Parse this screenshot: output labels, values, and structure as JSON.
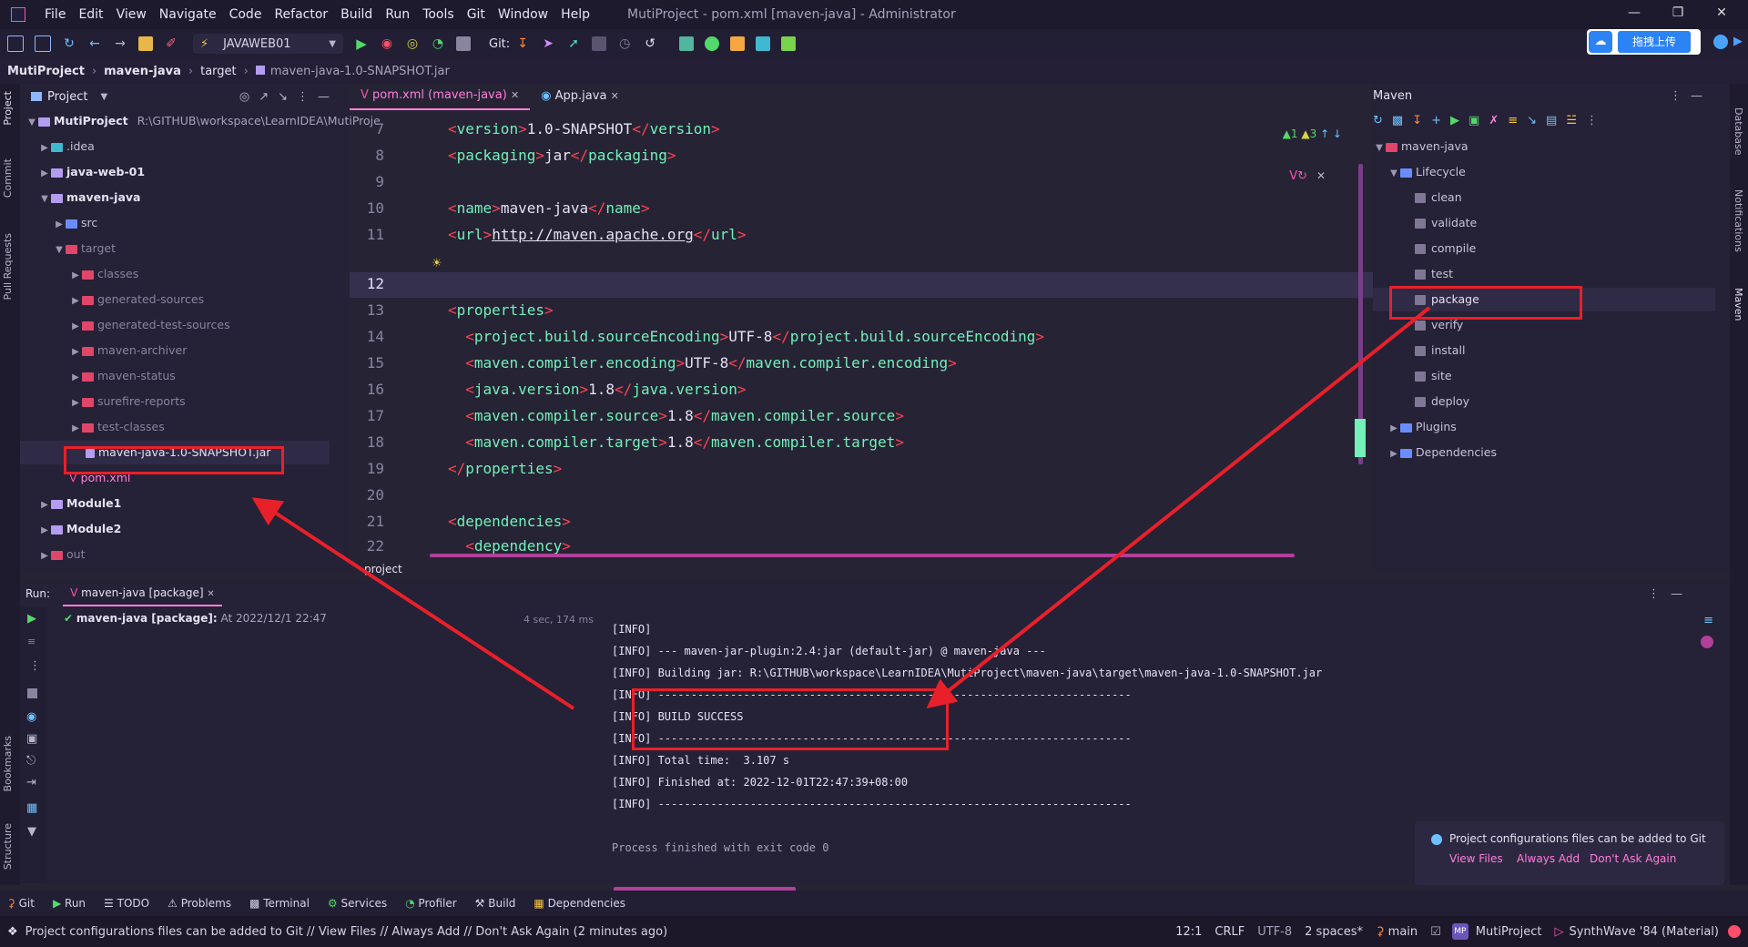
{
  "menubar": {
    "items": [
      "File",
      "Edit",
      "View",
      "Navigate",
      "Code",
      "Refactor",
      "Build",
      "Run",
      "Tools",
      "Git",
      "Window",
      "Help"
    ],
    "title": "MutiProject - pom.xml [maven-java] - Administrator"
  },
  "toolbar": {
    "run_config": "JAVAWEB01",
    "git_label": "Git:",
    "upload_label": "拖拽上传"
  },
  "breadcrumb": [
    "MutiProject",
    "maven-java",
    "target",
    "maven-java-1.0-SNAPSHOT.jar"
  ],
  "left_stripe": [
    "Project",
    "Commit",
    "Pull Requests",
    "Bookmarks",
    "Structure"
  ],
  "project_panel": {
    "title": "Project",
    "root_name": "MutiProject",
    "root_path": "R:\\GITHUB\\workspace\\LearnIDEA\\MutiProje",
    "items": {
      "idea": ".idea",
      "java_web": "java-web-01",
      "maven_java": "maven-java",
      "src": "src",
      "target": "target",
      "classes": "classes",
      "gen_sources": "generated-sources",
      "gen_test_sources": "generated-test-sources",
      "archiver": "maven-archiver",
      "status": "maven-status",
      "surefire": "surefire-reports",
      "test_classes": "test-classes",
      "jar": "maven-java-1.0-SNAPSHOT.jar",
      "pom": "pom.xml",
      "module1": "Module1",
      "module2": "Module2",
      "out": "out"
    }
  },
  "editor": {
    "tabs": [
      "pom.xml (maven-java)",
      "App.java"
    ],
    "inspections": {
      "warnings": "1",
      "weak": "3"
    },
    "lines": {
      "n7": "7",
      "n8": "8",
      "n9": "9",
      "n10": "10",
      "n11": "11",
      "n12": "12",
      "n13": "13",
      "n14": "14",
      "n15": "15",
      "n16": "16",
      "n17": "17",
      "n18": "18",
      "n19": "19",
      "n20": "20",
      "n21": "21",
      "n22": "22",
      "version_val": "1.0-SNAPSHOT",
      "packaging_val": "jar",
      "name_val": "maven-java",
      "url_val": "http://maven.apache.org",
      "encoding_val": "UTF-8",
      "compiler_encoding_val": "UTF-8",
      "java_version_val": "1.8",
      "source_val": "1.8",
      "target_val": "1.8"
    },
    "breadcrumb_bottom": "project"
  },
  "maven": {
    "title": "Maven",
    "project": "maven-java",
    "lifecycle": "Lifecycle",
    "goals": [
      "clean",
      "validate",
      "compile",
      "test",
      "package",
      "verify",
      "install",
      "site",
      "deploy"
    ],
    "plugins": "Plugins",
    "dependencies": "Dependencies"
  },
  "right_stripe": [
    "Database",
    "Notifications",
    "Maven"
  ],
  "run": {
    "label": "Run:",
    "tab": "maven-java [package]",
    "task": "maven-java [package]:",
    "task_time": "At 2022/12/1 22:47",
    "duration": "4 sec, 174 ms",
    "console": [
      "[INFO]",
      "[INFO] --- maven-jar-plugin:2.4:jar (default-jar) @ maven-java ---",
      "[INFO] Building jar: R:\\GITHUB\\workspace\\LearnIDEA\\MutiProject\\maven-java\\target\\maven-java-1.0-SNAPSHOT.jar",
      "[INFO] ------------------------------------------------------------------------",
      "[INFO] BUILD SUCCESS",
      "[INFO] ------------------------------------------------------------------------",
      "[INFO] Total time:  3.107 s",
      "[INFO] Finished at: 2022-12-01T22:47:39+08:00",
      "[INFO] ------------------------------------------------------------------------",
      "",
      "Process finished with exit code 0"
    ]
  },
  "tool_tabs": [
    "Git",
    "Run",
    "TODO",
    "Problems",
    "Terminal",
    "Services",
    "Profiler",
    "Build",
    "Dependencies"
  ],
  "notification": {
    "message": "Project configurations files can be added to Git",
    "view_files": "View Files",
    "always_add": "Always Add",
    "dont_ask": "Don't Ask Again"
  },
  "status_bar": {
    "message": "Project configurations files can be added to Git // View Files // Always Add // Don't Ask Again (2 minutes ago)",
    "position": "12:1",
    "line_sep": "CRLF",
    "encoding": "UTF-8",
    "indent": "2 spaces*",
    "branch": "main",
    "project": "MutiProject",
    "theme": "SynthWave '84 (Material)"
  },
  "colors": {
    "background": "#262335",
    "accent_pink": "#ff7edb",
    "tag_green": "#72f1b8",
    "annotation_red": "#e8202a"
  }
}
